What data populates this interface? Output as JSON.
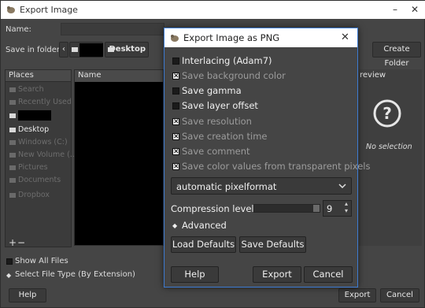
{
  "main_window": {
    "title": "Export Image",
    "name_label": "Name:",
    "name_value": "",
    "save_in_label": "Save in folder:",
    "path_segments": [
      "",
      "Desktop"
    ],
    "create_folder": "Create Folder",
    "places_header": "Places",
    "name_header": "Name",
    "preview_header": "review",
    "no_selection": "No selection",
    "places": [
      {
        "label": "Search",
        "active": false
      },
      {
        "label": "Recently Used",
        "active": false
      },
      {
        "label": "",
        "active": false
      },
      {
        "label": "Desktop",
        "active": true
      },
      {
        "label": "Windows (C:)",
        "active": false
      },
      {
        "label": "New Volume (...",
        "active": false
      },
      {
        "label": "Pictures",
        "active": false
      },
      {
        "label": "Documents",
        "active": false
      },
      {
        "label": "Dropbox",
        "active": false
      }
    ],
    "show_all_files": "Show All Files",
    "select_file_type": "Select File Type (By Extension)",
    "help": "Help",
    "export": "Export",
    "cancel": "Cancel"
  },
  "dialog": {
    "title": "Export Image as PNG",
    "options": [
      {
        "label": "Interlacing (Adam7)",
        "checked": false
      },
      {
        "label": "Save background color",
        "checked": true
      },
      {
        "label": "Save gamma",
        "checked": false
      },
      {
        "label": "Save layer offset",
        "checked": false
      },
      {
        "label": "Save resolution",
        "checked": true
      },
      {
        "label": "Save creation time",
        "checked": true
      },
      {
        "label": "Save comment",
        "checked": true
      },
      {
        "label": "Save color values from transparent pixels",
        "checked": true
      }
    ],
    "pixelformat": "automatic pixelformat",
    "compression_label": "Compression level:",
    "compression_value": "9",
    "advanced": "Advanced",
    "load_defaults": "Load Defaults",
    "save_defaults": "Save Defaults",
    "help": "Help",
    "export": "Export",
    "cancel": "Cancel"
  },
  "colors": {
    "background": "#454545",
    "dialog_border": "#3d7bd2",
    "checkbox_on": "#e9e9e9",
    "checkbox_off": "#1b1b1b"
  }
}
